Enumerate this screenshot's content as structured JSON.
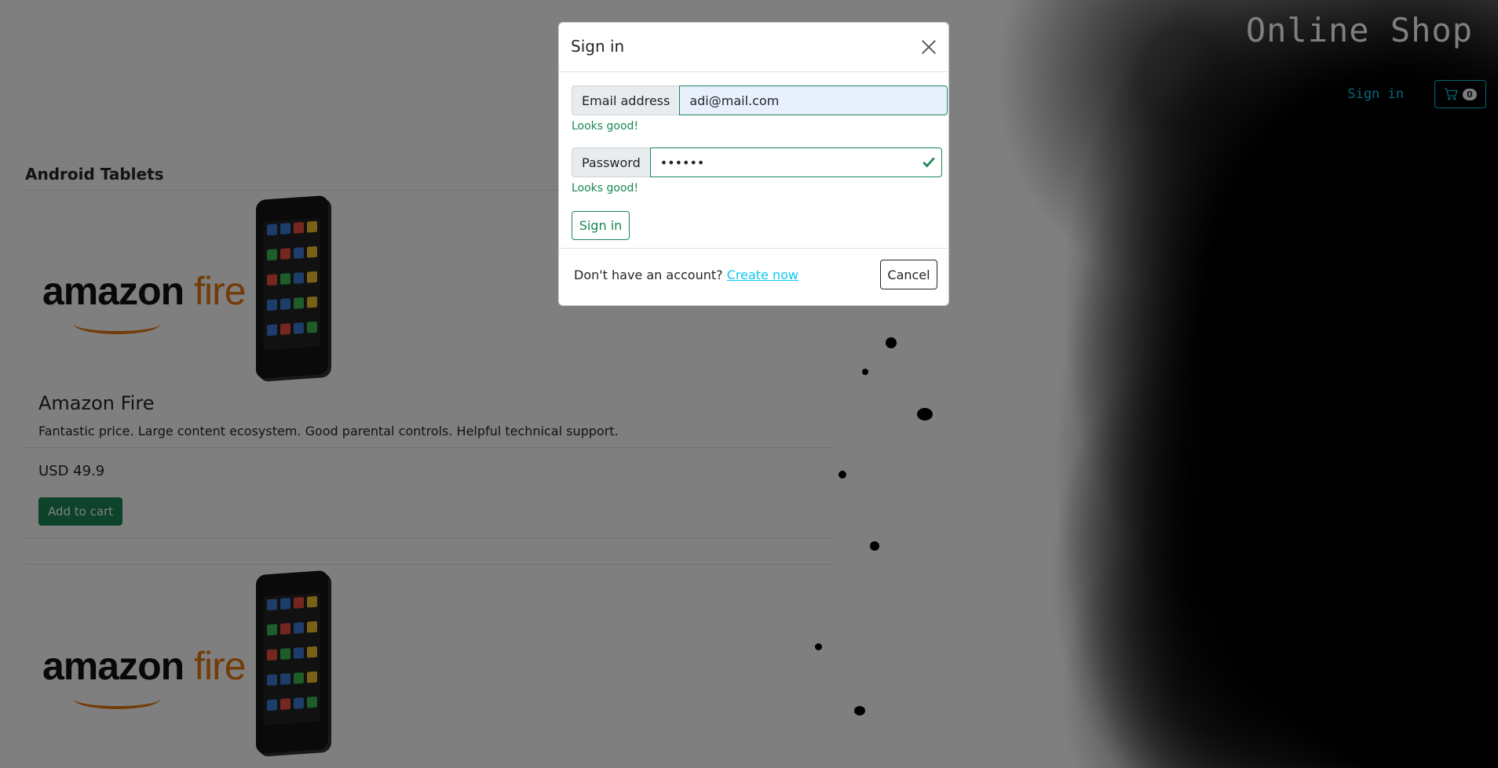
{
  "header": {
    "brand": "Online Shop",
    "signin_link": "Sign in",
    "cart_count": "0"
  },
  "catalog": {
    "section_title": "Android Tablets",
    "products": [
      {
        "name": "Amazon Fire",
        "description": "Fantastic price. Large content ecosystem. Good parental controls. Helpful technical support.",
        "price": "USD 49.9",
        "add_to_cart_label": "Add to cart",
        "image_logo_left": "amazon",
        "image_logo_right": "fire"
      },
      {
        "image_logo_left": "amazon",
        "image_logo_right": "fire"
      }
    ]
  },
  "modal": {
    "title": "Sign in",
    "email_label": "Email address",
    "email_value": "adi@mail.com",
    "email_feedback": "Looks good!",
    "password_label": "Password",
    "password_value": "••••••",
    "password_feedback": "Looks good!",
    "submit_label": "Sign in",
    "footer_prompt": "Don't have an account?",
    "footer_link": "Create now",
    "cancel_label": "Cancel"
  },
  "colors": {
    "success": "#198754",
    "info": "#0dcaf0",
    "brand_orange": "#e47911"
  }
}
